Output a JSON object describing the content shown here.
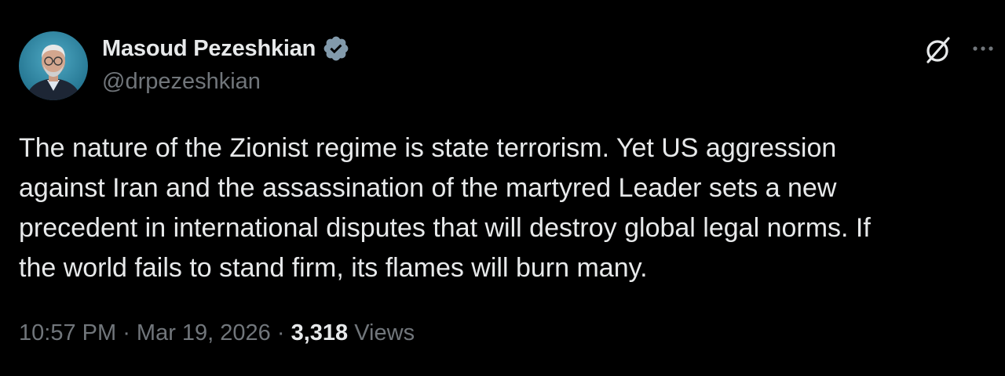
{
  "author": {
    "display_name": "Masoud Pezeshkian",
    "handle": "@drpezeshkian",
    "verified": true
  },
  "tweet": {
    "lines": [
      "The nature of the Zionist regime is state terrorism. Yet US aggression",
      "against Iran and the assassination of the martyred Leader sets a new",
      "precedent in international disputes that will destroy global legal norms. If",
      "the world fails to stand firm, its flames will burn many."
    ],
    "time": "10:57 PM",
    "separator": " · ",
    "date": "Mar 19, 2026",
    "views_count": "3,318",
    "views_label": "Views"
  },
  "icons": {
    "verified": "verified-badge-icon",
    "grok": "grok-icon",
    "more": "more-options-icon"
  },
  "colors": {
    "background": "#000000",
    "text_primary": "#e7e9ea",
    "text_secondary": "#71767b",
    "verified_badge": "#829aab"
  }
}
